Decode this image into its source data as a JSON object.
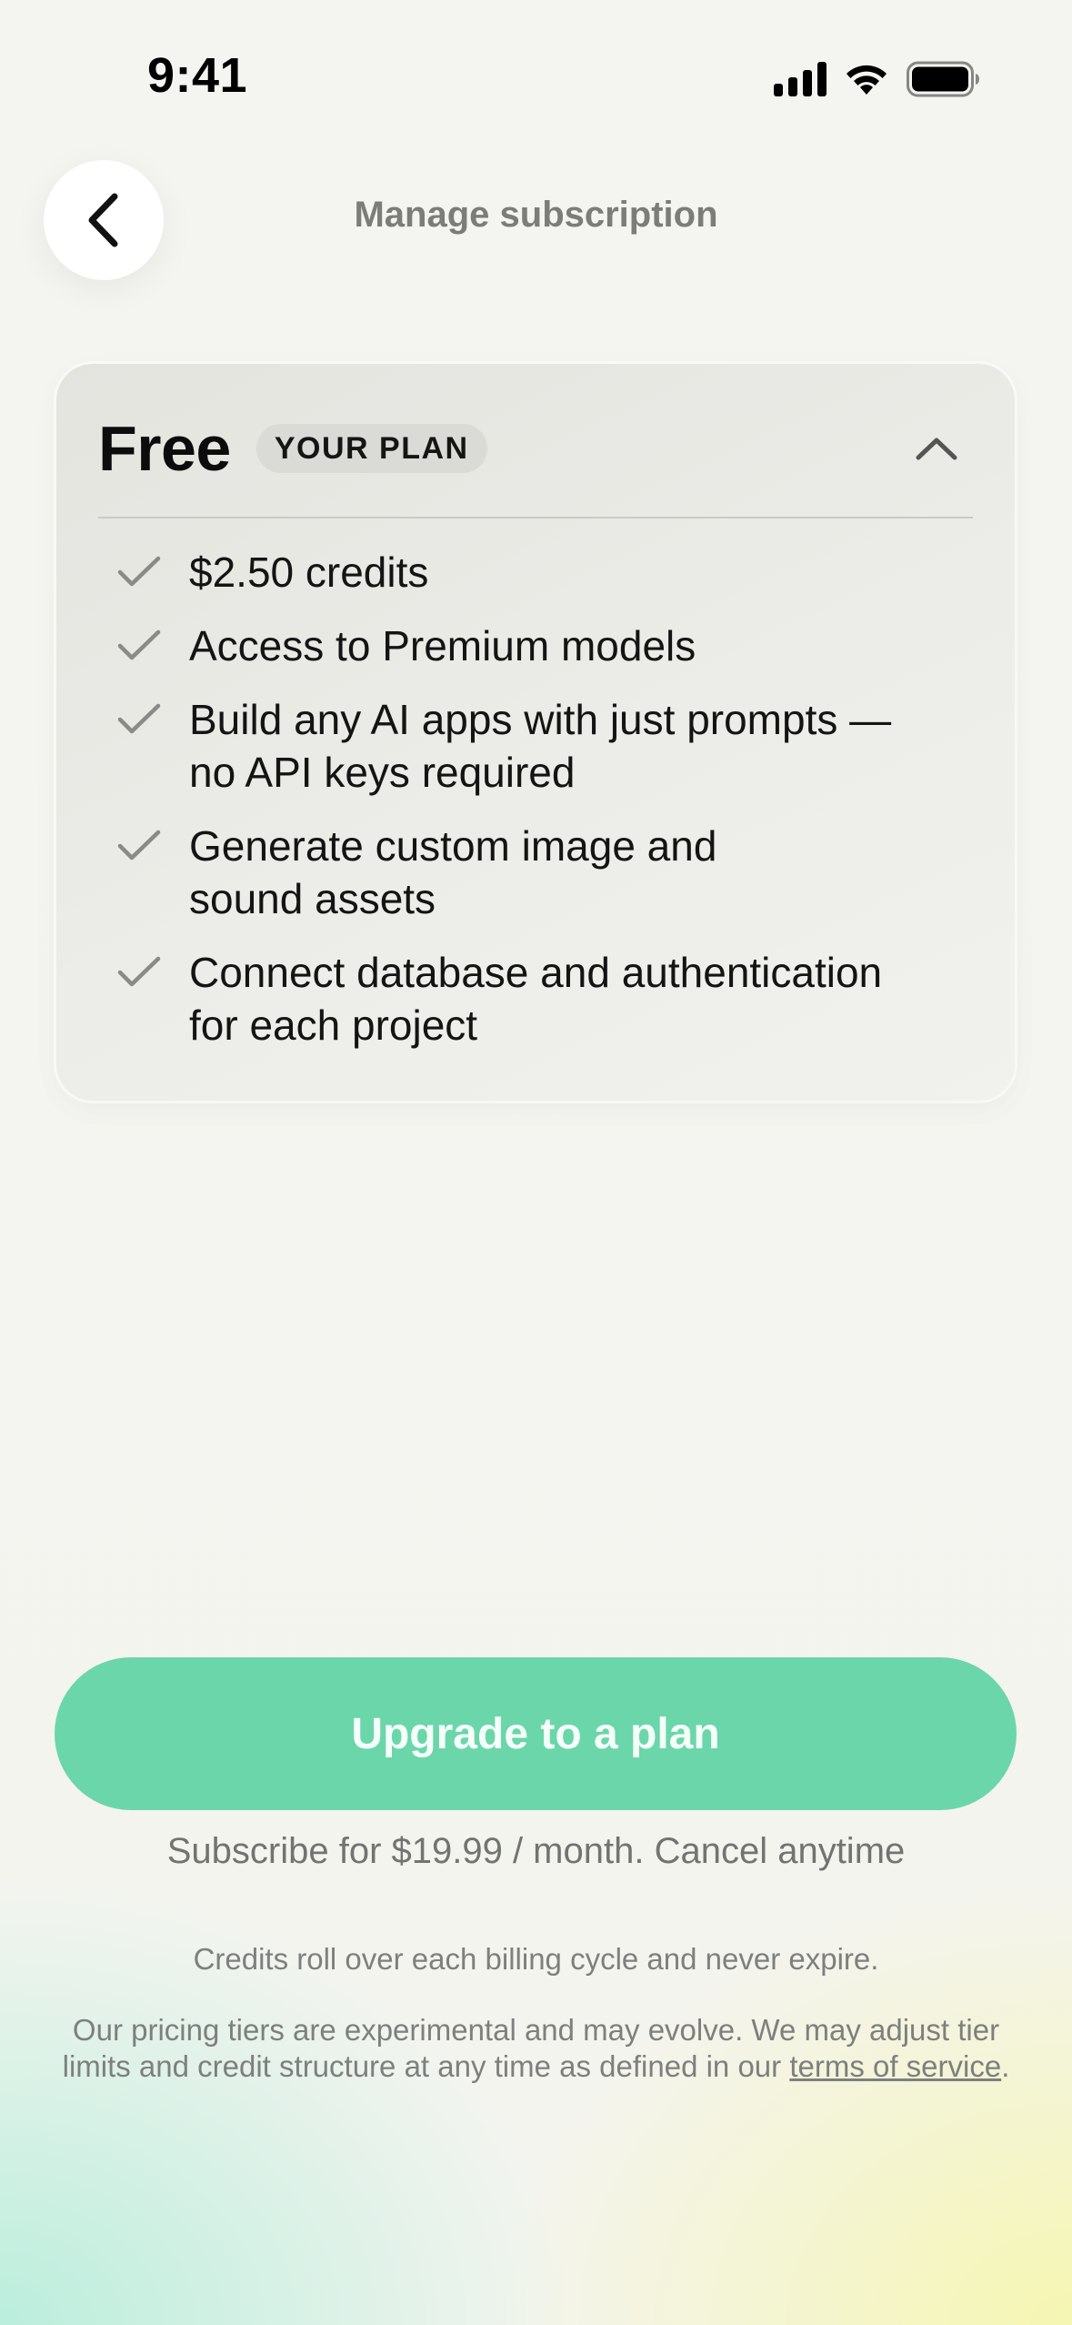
{
  "status_bar": {
    "time": "9:41"
  },
  "header": {
    "title": "Manage subscription",
    "back_icon": "chevron-left-icon"
  },
  "plan": {
    "name": "Free",
    "badge": "YOUR PLAN",
    "toggle_icon": "chevron-up-icon",
    "features": [
      {
        "line1": "$2.50 credits",
        "line2": ""
      },
      {
        "line1": "Access to Premium models",
        "line2": ""
      },
      {
        "line1": "Build any AI apps with just prompts —",
        "line2": "no API keys required"
      },
      {
        "line1": "Generate custom image and",
        "line2": "sound assets"
      },
      {
        "line1": "Connect database and authentication",
        "line2": "for each project"
      }
    ]
  },
  "upgrade": {
    "button_label": "Upgrade to a plan",
    "subscribe_note": "Subscribe for $19.99 / month. Cancel anytime"
  },
  "footer": {
    "credits_note": "Credits roll over each billing cycle and never expire.",
    "disclaimer_prefix": "Our pricing tiers are experimental and may evolve. We may adjust tier limits and credit structure at any time as defined in our",
    "terms_link": "terms of service",
    "disclaimer_suffix": "."
  },
  "colors": {
    "accent": "#6bd6aa",
    "muted_text": "#7d807d",
    "card_bg": "#e8e8e4"
  }
}
